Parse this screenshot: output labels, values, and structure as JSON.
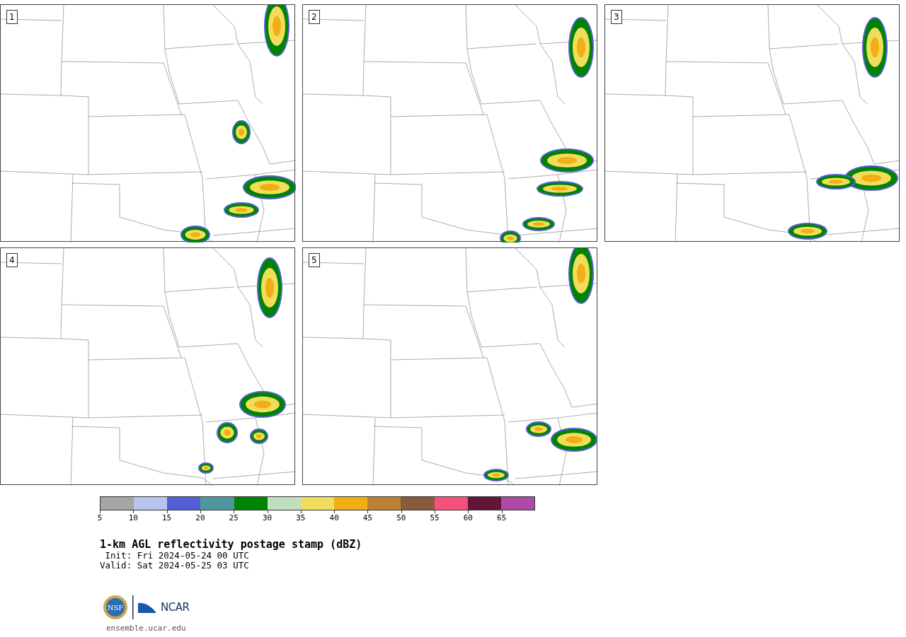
{
  "panels": [
    {
      "label": "1"
    },
    {
      "label": "2"
    },
    {
      "label": "3"
    },
    {
      "label": "4"
    },
    {
      "label": "5"
    }
  ],
  "colorbar": {
    "bins": [
      {
        "color": "#a6a6a6"
      },
      {
        "color": "#b8c3ee"
      },
      {
        "color": "#525fd6"
      },
      {
        "color": "#4f979e"
      },
      {
        "color": "#008300"
      },
      {
        "color": "#bfdfbf"
      },
      {
        "color": "#f1dd5c"
      },
      {
        "color": "#f1ae15"
      },
      {
        "color": "#bb8231"
      },
      {
        "color": "#8a5a3c"
      },
      {
        "color": "#f5507e"
      },
      {
        "color": "#631638"
      },
      {
        "color": "#ad4ba7"
      }
    ],
    "ticks": [
      "5",
      "10",
      "15",
      "20",
      "25",
      "30",
      "35",
      "40",
      "45",
      "50",
      "55",
      "60",
      "65"
    ]
  },
  "title": "1-km AGL reflectivity postage stamp (dBZ)",
  "init": " Init: Fri 2024-05-24 00 UTC",
  "valid": "Valid: Sat 2024-05-25 03 UTC",
  "logo": {
    "left": "NSF",
    "right": "NCAR"
  },
  "footer": "ensemble.ucar.edu"
}
